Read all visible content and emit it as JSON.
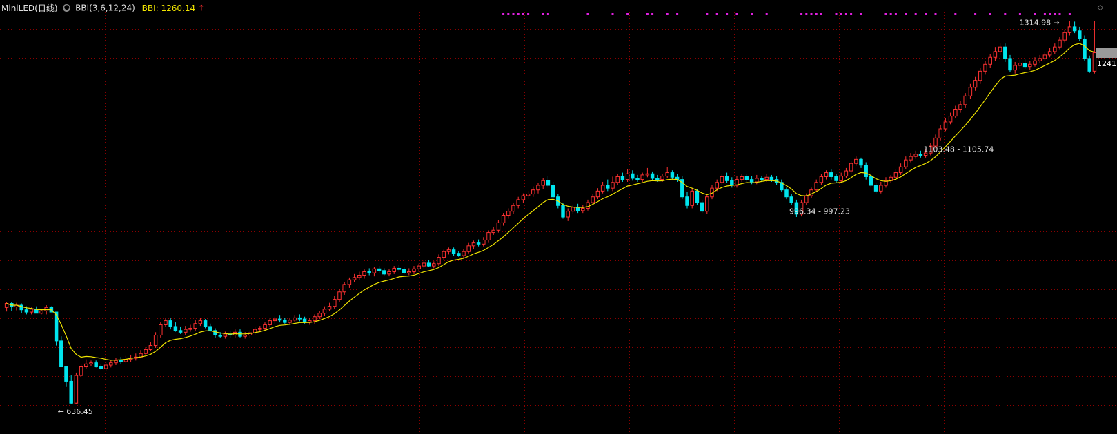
{
  "header": {
    "instrument": "MiniLED(日线)",
    "indicator": "BBI(3,6,12,24)",
    "bbi_label": "BBI: 1260.14",
    "arrow": "↑"
  },
  "colors": {
    "up": "#ff3232",
    "down": "#00e5ee",
    "bbi": "#f0e400",
    "grid": "#8b0000",
    "signal": "#e020e0",
    "bg": "#000000"
  },
  "chart_data": {
    "type": "candlestick",
    "title": "MiniLED(日线)",
    "ylim": [
      620,
      1330
    ],
    "annotations": {
      "low": {
        "value": 636.45,
        "text": "636.45",
        "index": 10
      },
      "high": {
        "value": 1314.98,
        "text": "1314.98",
        "index": 215
      },
      "zone1": {
        "text": "1103.48 - 1105.74",
        "value": 1104.6,
        "from_index": 184
      },
      "zone2": {
        "text": "996.34 - 997.23",
        "value": 996.8,
        "from_index": 157
      },
      "current": {
        "text": "1241",
        "value": 1241
      }
    },
    "signal_marks_indices": [
      100,
      101,
      102,
      103,
      104,
      105,
      108,
      109,
      117,
      122,
      125,
      129,
      130,
      133,
      135,
      141,
      143,
      145,
      147,
      150,
      153,
      160,
      161,
      162,
      163,
      164,
      167,
      168,
      169,
      170,
      172,
      177,
      178,
      179,
      181,
      183,
      185,
      187,
      191,
      195,
      198,
      201,
      204,
      207,
      209,
      210,
      211,
      212,
      214
    ],
    "candles": [
      [
        818,
        825,
        811,
        828,
        806
      ],
      [
        825,
        819,
        812,
        828,
        808
      ],
      [
        819,
        822,
        813,
        826,
        809
      ],
      [
        822,
        814,
        808,
        825,
        800
      ],
      [
        814,
        810,
        806,
        820,
        802
      ],
      [
        810,
        815,
        806,
        818,
        800
      ],
      [
        815,
        808,
        812,
        820,
        806
      ],
      [
        808,
        812,
        806,
        816,
        795
      ],
      [
        812,
        818,
        806,
        822,
        804
      ],
      [
        818,
        810,
        811,
        820,
        806
      ],
      [
        810,
        760,
        752,
        800,
        738
      ],
      [
        760,
        715,
        715,
        768,
        700
      ],
      [
        715,
        690,
        680,
        705,
        676
      ],
      [
        690,
        652,
        650,
        700,
        636
      ],
      [
        652,
        700,
        650,
        705,
        648
      ],
      [
        700,
        715,
        698,
        720,
        690
      ],
      [
        715,
        720,
        712,
        728,
        708
      ],
      [
        720,
        722,
        716,
        726,
        710
      ],
      [
        722,
        715,
        714,
        726,
        710
      ],
      [
        715,
        712,
        710,
        720,
        706
      ],
      [
        712,
        718,
        708,
        722,
        704
      ],
      [
        718,
        722,
        714,
        726,
        712
      ],
      [
        722,
        726,
        718,
        730,
        714
      ],
      [
        726,
        724,
        720,
        732,
        718
      ],
      [
        724,
        728,
        722,
        734,
        720
      ],
      [
        728,
        730,
        724,
        736,
        722
      ],
      [
        730,
        732,
        726,
        738,
        724
      ],
      [
        732,
        738,
        730,
        744,
        728
      ],
      [
        738,
        745,
        736,
        750,
        734
      ],
      [
        745,
        752,
        742,
        758,
        740
      ],
      [
        752,
        770,
        748,
        775,
        745
      ],
      [
        770,
        788,
        766,
        792,
        764
      ],
      [
        788,
        795,
        784,
        800,
        782
      ],
      [
        795,
        785,
        780,
        800,
        778
      ],
      [
        785,
        778,
        776,
        792,
        770
      ],
      [
        778,
        775,
        772,
        785,
        768
      ],
      [
        775,
        780,
        770,
        786,
        766
      ],
      [
        780,
        782,
        776,
        788,
        772
      ],
      [
        782,
        790,
        778,
        796,
        776
      ],
      [
        790,
        795,
        786,
        800,
        782
      ],
      [
        795,
        785,
        782,
        798,
        778
      ],
      [
        785,
        778,
        776,
        790,
        770
      ],
      [
        778,
        770,
        766,
        782,
        762
      ],
      [
        770,
        768,
        765,
        775,
        760
      ],
      [
        768,
        772,
        764,
        776,
        758
      ],
      [
        772,
        770,
        766,
        778,
        762
      ],
      [
        770,
        775,
        766,
        780,
        764
      ],
      [
        775,
        768,
        766,
        780,
        760
      ],
      [
        768,
        770,
        764,
        775,
        760
      ],
      [
        770,
        774,
        766,
        778,
        762
      ],
      [
        774,
        780,
        770,
        784,
        768
      ],
      [
        780,
        782,
        776,
        786,
        772
      ],
      [
        782,
        788,
        778,
        792,
        776
      ],
      [
        788,
        795,
        784,
        800,
        782
      ],
      [
        795,
        798,
        790,
        802,
        786
      ],
      [
        798,
        796,
        792,
        805,
        790
      ],
      [
        796,
        792,
        790,
        800,
        788
      ],
      [
        792,
        796,
        788,
        800,
        786
      ],
      [
        796,
        800,
        792,
        805,
        790
      ],
      [
        800,
        798,
        794,
        806,
        792
      ],
      [
        798,
        792,
        790,
        802,
        788
      ],
      [
        792,
        795,
        788,
        800,
        786
      ],
      [
        795,
        802,
        790,
        806,
        788
      ],
      [
        802,
        808,
        798,
        812,
        796
      ],
      [
        808,
        815,
        804,
        820,
        800
      ],
      [
        815,
        820,
        812,
        826,
        810
      ],
      [
        820,
        832,
        816,
        838,
        812
      ],
      [
        832,
        845,
        828,
        850,
        824
      ],
      [
        845,
        858,
        840,
        862,
        836
      ],
      [
        858,
        866,
        852,
        870,
        848
      ],
      [
        866,
        870,
        862,
        876,
        856
      ],
      [
        870,
        874,
        866,
        880,
        862
      ],
      [
        874,
        880,
        868,
        884,
        864
      ],
      [
        880,
        878,
        874,
        886,
        870
      ],
      [
        878,
        885,
        872,
        888,
        868
      ],
      [
        885,
        882,
        878,
        890,
        876
      ],
      [
        882,
        876,
        874,
        886,
        870
      ],
      [
        876,
        880,
        872,
        884,
        866
      ],
      [
        880,
        886,
        876,
        890,
        872
      ],
      [
        886,
        884,
        880,
        892,
        878
      ],
      [
        884,
        878,
        876,
        888,
        872
      ],
      [
        878,
        880,
        874,
        886,
        870
      ],
      [
        880,
        885,
        876,
        890,
        874
      ],
      [
        885,
        890,
        880,
        894,
        876
      ],
      [
        890,
        895,
        886,
        900,
        882
      ],
      [
        895,
        890,
        888,
        900,
        884
      ],
      [
        890,
        894,
        886,
        898,
        882
      ],
      [
        894,
        905,
        890,
        910,
        888
      ],
      [
        905,
        915,
        900,
        918,
        898
      ],
      [
        915,
        918,
        910,
        922,
        906
      ],
      [
        918,
        912,
        908,
        922,
        904
      ],
      [
        912,
        908,
        906,
        916,
        900
      ],
      [
        908,
        915,
        904,
        920,
        900
      ],
      [
        915,
        925,
        912,
        930,
        910
      ],
      [
        925,
        930,
        920,
        934,
        918
      ],
      [
        930,
        928,
        924,
        936,
        920
      ],
      [
        928,
        935,
        924,
        940,
        922
      ],
      [
        935,
        948,
        930,
        952,
        928
      ],
      [
        948,
        952,
        944,
        958,
        940
      ],
      [
        952,
        965,
        948,
        970,
        944
      ],
      [
        965,
        978,
        960,
        982,
        956
      ],
      [
        978,
        985,
        972,
        990,
        968
      ],
      [
        985,
        995,
        980,
        1000,
        976
      ],
      [
        995,
        1005,
        990,
        1010,
        986
      ],
      [
        1005,
        1012,
        1000,
        1016,
        996
      ],
      [
        1012,
        1015,
        1006,
        1020,
        1000
      ],
      [
        1015,
        1022,
        1010,
        1028,
        1004
      ],
      [
        1022,
        1030,
        1016,
        1034,
        1012
      ],
      [
        1030,
        1038,
        1024,
        1042,
        1018
      ],
      [
        1038,
        1030,
        1026,
        1046,
        1022
      ],
      [
        1030,
        1010,
        1005,
        1036,
        994
      ],
      [
        1010,
        995,
        990,
        1015,
        970
      ],
      [
        995,
        975,
        972,
        1000,
        958
      ],
      [
        975,
        985,
        968,
        990,
        962
      ],
      [
        985,
        992,
        980,
        996,
        976
      ],
      [
        992,
        986,
        982,
        998,
        978
      ],
      [
        986,
        990,
        982,
        996,
        980
      ],
      [
        990,
        1000,
        986,
        1005,
        982
      ],
      [
        1000,
        1010,
        996,
        1015,
        992
      ],
      [
        1010,
        1020,
        1006,
        1025,
        1002
      ],
      [
        1020,
        1030,
        1016,
        1036,
        1010
      ],
      [
        1030,
        1025,
        1020,
        1040,
        1016
      ],
      [
        1025,
        1035,
        1020,
        1045,
        1015
      ],
      [
        1035,
        1045,
        1030,
        1050,
        1026
      ],
      [
        1045,
        1040,
        1036,
        1052,
        1030
      ],
      [
        1040,
        1050,
        1036,
        1058,
        1032
      ],
      [
        1050,
        1042,
        1038,
        1056,
        1034
      ],
      [
        1042,
        1040,
        1036,
        1048,
        1030
      ],
      [
        1040,
        1048,
        1036,
        1052,
        1032
      ],
      [
        1048,
        1050,
        1044,
        1060,
        1040
      ],
      [
        1050,
        1042,
        1038,
        1054,
        1034
      ],
      [
        1042,
        1040,
        1036,
        1048,
        1030
      ],
      [
        1040,
        1046,
        1036,
        1050,
        1032
      ],
      [
        1046,
        1052,
        1042,
        1062,
        1038
      ],
      [
        1052,
        1044,
        1040,
        1056,
        1036
      ],
      [
        1044,
        1040,
        1036,
        1050,
        1032
      ],
      [
        1040,
        1010,
        1006,
        1046,
        998
      ],
      [
        1010,
        995,
        990,
        1018,
        985
      ],
      [
        995,
        1020,
        990,
        1025,
        986
      ],
      [
        1020,
        1000,
        996,
        1024,
        990
      ],
      [
        1000,
        985,
        982,
        1005,
        978
      ],
      [
        985,
        1010,
        980,
        1015,
        976
      ],
      [
        1010,
        1025,
        1006,
        1030,
        1000
      ],
      [
        1025,
        1035,
        1020,
        1040,
        1016
      ],
      [
        1035,
        1045,
        1030,
        1050,
        1026
      ],
      [
        1045,
        1038,
        1034,
        1052,
        1030
      ],
      [
        1038,
        1030,
        1026,
        1044,
        1020
      ],
      [
        1030,
        1040,
        1026,
        1046,
        1022
      ],
      [
        1040,
        1045,
        1036,
        1050,
        1032
      ],
      [
        1045,
        1040,
        1036,
        1050,
        1030
      ],
      [
        1040,
        1036,
        1032,
        1046,
        1028
      ],
      [
        1036,
        1042,
        1032,
        1048,
        1030
      ],
      [
        1042,
        1040,
        1036,
        1046,
        1032
      ],
      [
        1040,
        1044,
        1036,
        1050,
        1034
      ],
      [
        1044,
        1040,
        1036,
        1048,
        1032
      ],
      [
        1040,
        1035,
        1030,
        1046,
        1026
      ],
      [
        1035,
        1022,
        1018,
        1040,
        1012
      ],
      [
        1022,
        1010,
        1006,
        1026,
        1000
      ],
      [
        1010,
        1000,
        996,
        1015,
        990
      ],
      [
        1000,
        980,
        975,
        1005,
        970
      ],
      [
        980,
        1000,
        976,
        1005,
        972
      ],
      [
        1000,
        1012,
        996,
        1016,
        992
      ],
      [
        1012,
        1022,
        1008,
        1026,
        1004
      ],
      [
        1022,
        1035,
        1018,
        1040,
        1014
      ],
      [
        1035,
        1045,
        1030,
        1050,
        1026
      ],
      [
        1045,
        1052,
        1040,
        1056,
        1036
      ],
      [
        1052,
        1045,
        1040,
        1058,
        1036
      ],
      [
        1045,
        1038,
        1034,
        1050,
        1030
      ],
      [
        1038,
        1046,
        1034,
        1052,
        1030
      ],
      [
        1046,
        1055,
        1042,
        1060,
        1038
      ],
      [
        1055,
        1068,
        1050,
        1072,
        1046
      ],
      [
        1068,
        1075,
        1064,
        1080,
        1058
      ],
      [
        1075,
        1065,
        1060,
        1078,
        1056
      ],
      [
        1065,
        1045,
        1040,
        1070,
        1035
      ],
      [
        1045,
        1030,
        1026,
        1050,
        1020
      ],
      [
        1030,
        1020,
        1016,
        1035,
        1010
      ],
      [
        1020,
        1030,
        1016,
        1036,
        1012
      ],
      [
        1030,
        1038,
        1026,
        1044,
        1022
      ],
      [
        1038,
        1044,
        1034,
        1048,
        1030
      ],
      [
        1044,
        1052,
        1040,
        1058,
        1036
      ],
      [
        1052,
        1062,
        1048,
        1068,
        1044
      ],
      [
        1062,
        1074,
        1058,
        1080,
        1054
      ],
      [
        1074,
        1080,
        1070,
        1086,
        1066
      ],
      [
        1080,
        1084,
        1076,
        1090,
        1072
      ],
      [
        1084,
        1082,
        1078,
        1090,
        1074
      ],
      [
        1082,
        1086,
        1078,
        1092,
        1076
      ],
      [
        1086,
        1098,
        1082,
        1104,
        1078
      ],
      [
        1098,
        1112,
        1094,
        1118,
        1090
      ],
      [
        1112,
        1128,
        1108,
        1134,
        1104
      ],
      [
        1128,
        1140,
        1124,
        1146,
        1118
      ],
      [
        1140,
        1150,
        1136,
        1156,
        1130
      ],
      [
        1150,
        1162,
        1146,
        1168,
        1140
      ],
      [
        1162,
        1170,
        1156,
        1176,
        1150
      ],
      [
        1170,
        1185,
        1164,
        1190,
        1158
      ],
      [
        1185,
        1200,
        1180,
        1206,
        1174
      ],
      [
        1200,
        1212,
        1194,
        1218,
        1188
      ],
      [
        1212,
        1228,
        1206,
        1234,
        1200
      ],
      [
        1228,
        1240,
        1222,
        1246,
        1216
      ],
      [
        1240,
        1252,
        1234,
        1258,
        1228
      ],
      [
        1252,
        1262,
        1246,
        1270,
        1240
      ],
      [
        1262,
        1270,
        1256,
        1276,
        1250
      ],
      [
        1270,
        1250,
        1244,
        1276,
        1238
      ],
      [
        1250,
        1230,
        1226,
        1256,
        1218
      ],
      [
        1230,
        1238,
        1224,
        1244,
        1220
      ],
      [
        1238,
        1242,
        1232,
        1248,
        1226
      ],
      [
        1242,
        1236,
        1232,
        1250,
        1228
      ],
      [
        1236,
        1240,
        1230,
        1246,
        1226
      ],
      [
        1240,
        1246,
        1236,
        1252,
        1232
      ],
      [
        1246,
        1250,
        1242,
        1256,
        1238
      ],
      [
        1250,
        1256,
        1246,
        1262,
        1242
      ],
      [
        1256,
        1262,
        1252,
        1268,
        1248
      ],
      [
        1262,
        1270,
        1258,
        1276,
        1254
      ],
      [
        1270,
        1282,
        1266,
        1288,
        1260
      ],
      [
        1282,
        1295,
        1278,
        1300,
        1274
      ],
      [
        1295,
        1305,
        1290,
        1315,
        1286
      ],
      [
        1305,
        1298,
        1294,
        1314,
        1290
      ],
      [
        1298,
        1284,
        1280,
        1305,
        1274
      ],
      [
        1284,
        1250,
        1246,
        1290,
        1240
      ],
      [
        1250,
        1228,
        1225,
        1255,
        1222
      ],
      [
        1228,
        1260,
        1224,
        1315,
        1220
      ]
    ]
  }
}
